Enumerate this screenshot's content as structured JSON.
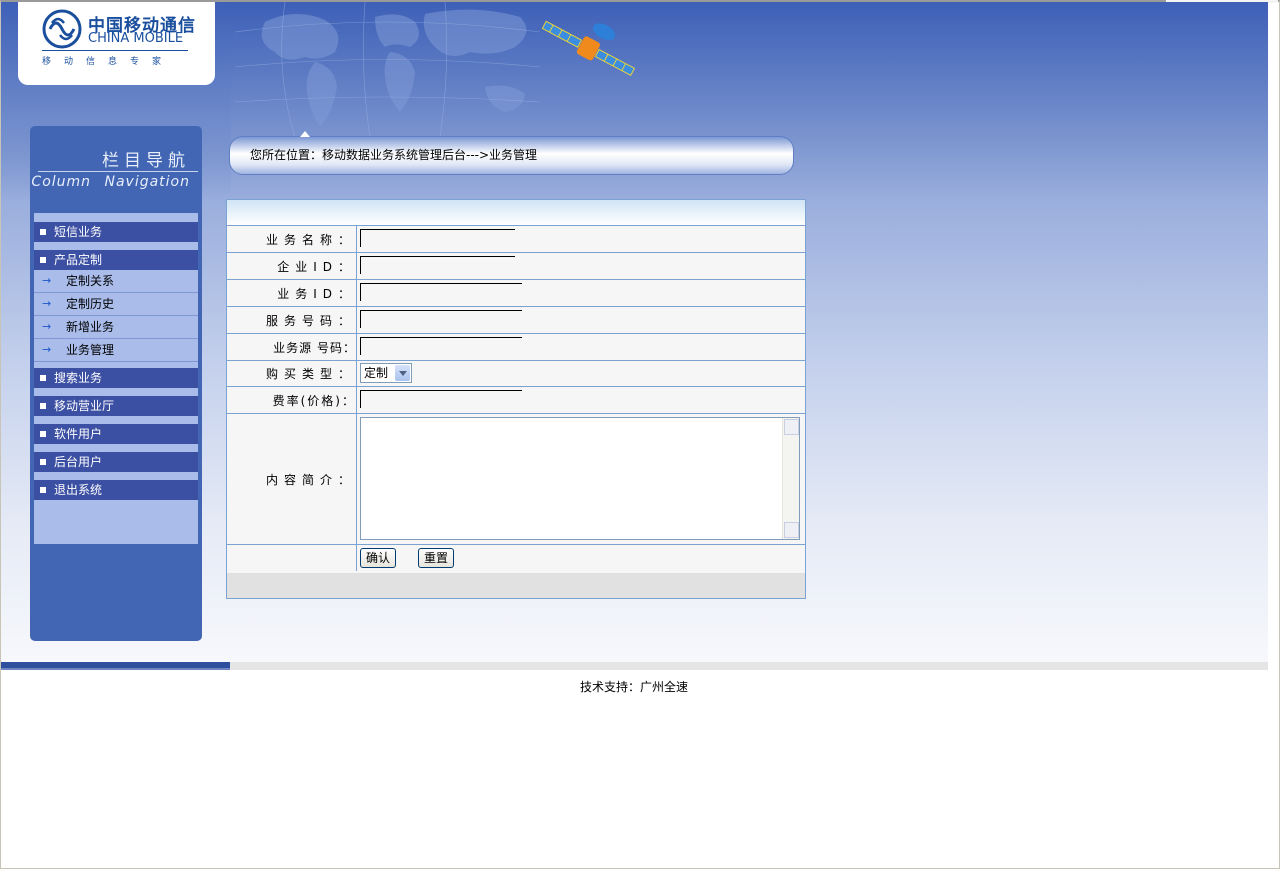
{
  "logo": {
    "cn": "中国移动通信",
    "en": "CHINA MOBILE",
    "sub": "移动信息专家"
  },
  "nav": {
    "title_cn": "栏目导航",
    "title_en": "Column Navigation",
    "items": [
      {
        "label": "短信业务"
      },
      {
        "label": "产品定制",
        "children": [
          "定制关系",
          "定制历史",
          "新增业务",
          "业务管理"
        ]
      },
      {
        "label": "搜索业务"
      },
      {
        "label": "移动营业厅"
      },
      {
        "label": "软件用户"
      },
      {
        "label": "后台用户"
      },
      {
        "label": "退出系统"
      }
    ]
  },
  "breadcrumb": "您所在位置：移动数据业务系统管理后台--->业务管理",
  "form": {
    "labels": {
      "name": "业务名称：",
      "ent_id": "企业ID：",
      "svc_id": "业务ID：",
      "svc_no": "服务号码：",
      "src_no": "业务源 号码：",
      "buy_type": "购买类型：",
      "price": "费率(价格)：",
      "desc": "内容简介："
    },
    "values": {
      "name": "",
      "ent_id": "",
      "svc_id": "",
      "svc_no": "",
      "src_no": "",
      "buy_type": "定制",
      "price": "",
      "desc": ""
    },
    "confirm": "确认",
    "reset": "重置"
  },
  "footer": "技术支持：广州全速",
  "colors": {
    "sidebar": "#4266b4",
    "menu_item": "#3b4fa3",
    "submenu": "#a9bcea",
    "table_border": "#7aa2d2",
    "brand_blue": "#1a4f9e"
  }
}
